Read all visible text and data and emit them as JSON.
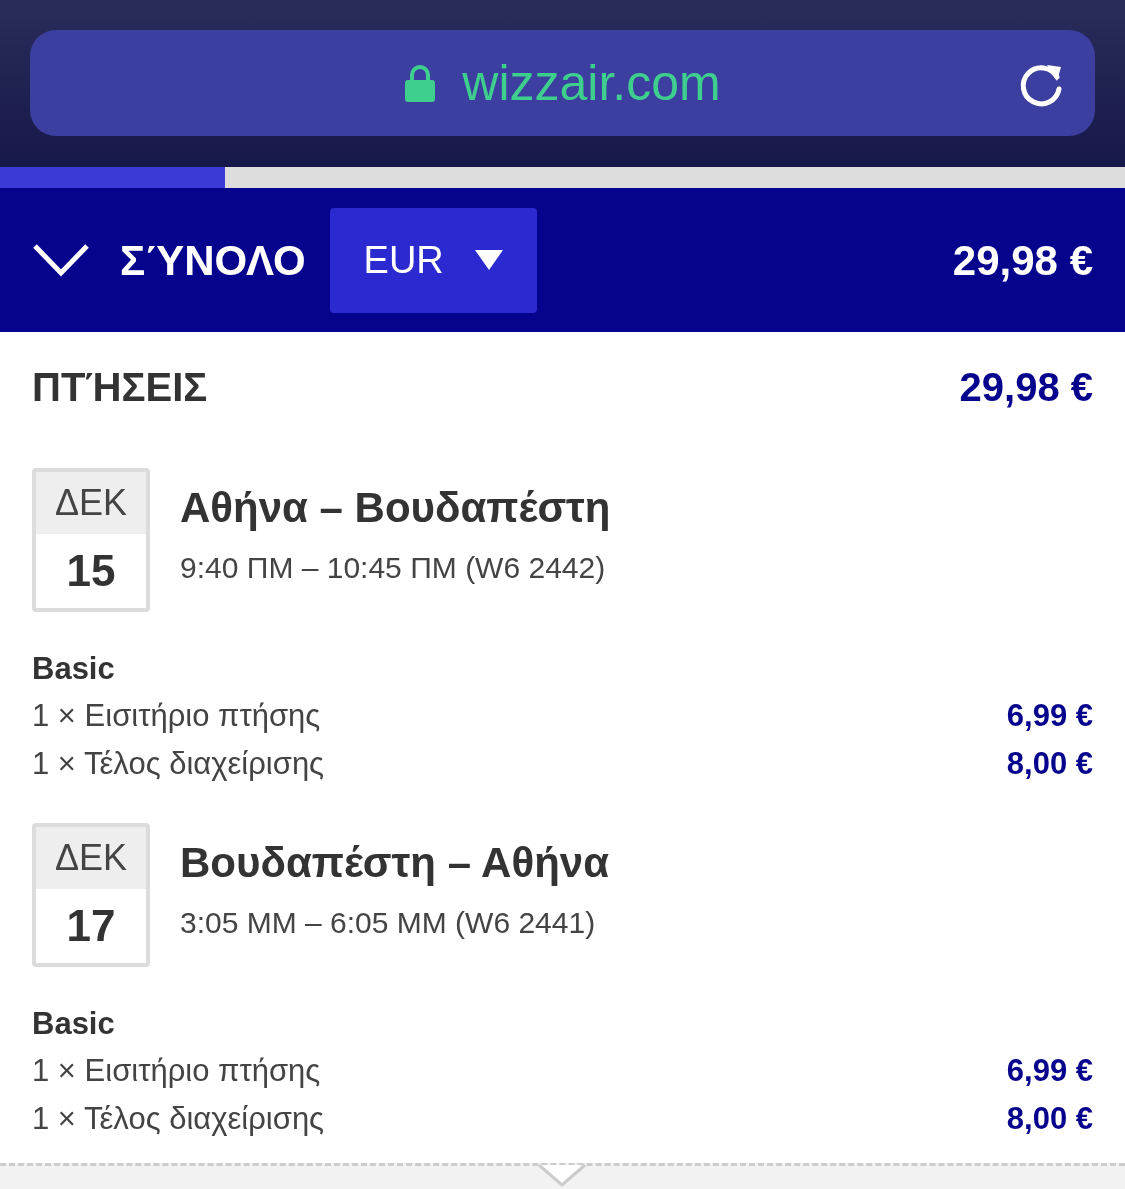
{
  "browser": {
    "url": "wizzair.com",
    "progress": {
      "level": 0.2
    }
  },
  "summary_bar": {
    "title": "ΣΎΝΟΛΟ",
    "expanded": false,
    "currency": "EUR",
    "total": "29,98 €"
  },
  "flights_section": {
    "title": "ΠΤΉΣΕΙΣ",
    "total": "29,98 €",
    "flights": [
      {
        "month": "ΔΕΚ",
        "day": "15",
        "route": "Αθήνα – Βουδαπέστη",
        "times": "9:40 ΠΜ – 10:45 ΠΜ (W6 2442)",
        "fare": "Basic",
        "items": [
          {
            "label": "1 × Εισιτήριο πτήσης",
            "price": "6,99 €"
          },
          {
            "label": "1 × Τέλος διαχείρισης",
            "price": "8,00 €"
          }
        ]
      },
      {
        "month": "ΔΕΚ",
        "day": "17",
        "route": "Βουδαπέστη – Αθήνα",
        "times": "3:05 ΜΜ – 6:05 ΜΜ (W6 2441)",
        "fare": "Basic",
        "items": [
          {
            "label": "1 × Εισιτήριο πτήσης",
            "price": "6,99 €"
          },
          {
            "label": "1 × Τέλος διαχείρισης",
            "price": "8,00 €"
          }
        ]
      }
    ]
  }
}
